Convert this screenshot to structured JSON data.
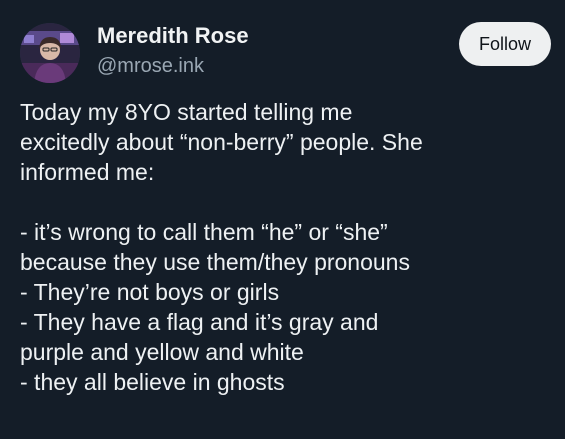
{
  "author": {
    "name": "Meredith Rose",
    "handle": "@mrose.ink",
    "avatar_icon": "user-avatar-icon"
  },
  "actions": {
    "follow_label": "Follow"
  },
  "post": {
    "paragraph1": [
      "Today my 8YO started telling me",
      "excitedly about “non-berry” people. She",
      "informed me:"
    ],
    "paragraph2": [
      "- it’s wrong to call them “he” or “she”",
      "because they use them/they pronouns",
      "- They’re not boys or girls",
      "- They have a flag and it’s gray and",
      "purple and yellow and white",
      "- they all believe in ghosts"
    ]
  },
  "colors": {
    "background": "#141d28",
    "text": "#eef1f3",
    "handle": "#9aa7b3",
    "button_bg": "#eef0f1"
  }
}
